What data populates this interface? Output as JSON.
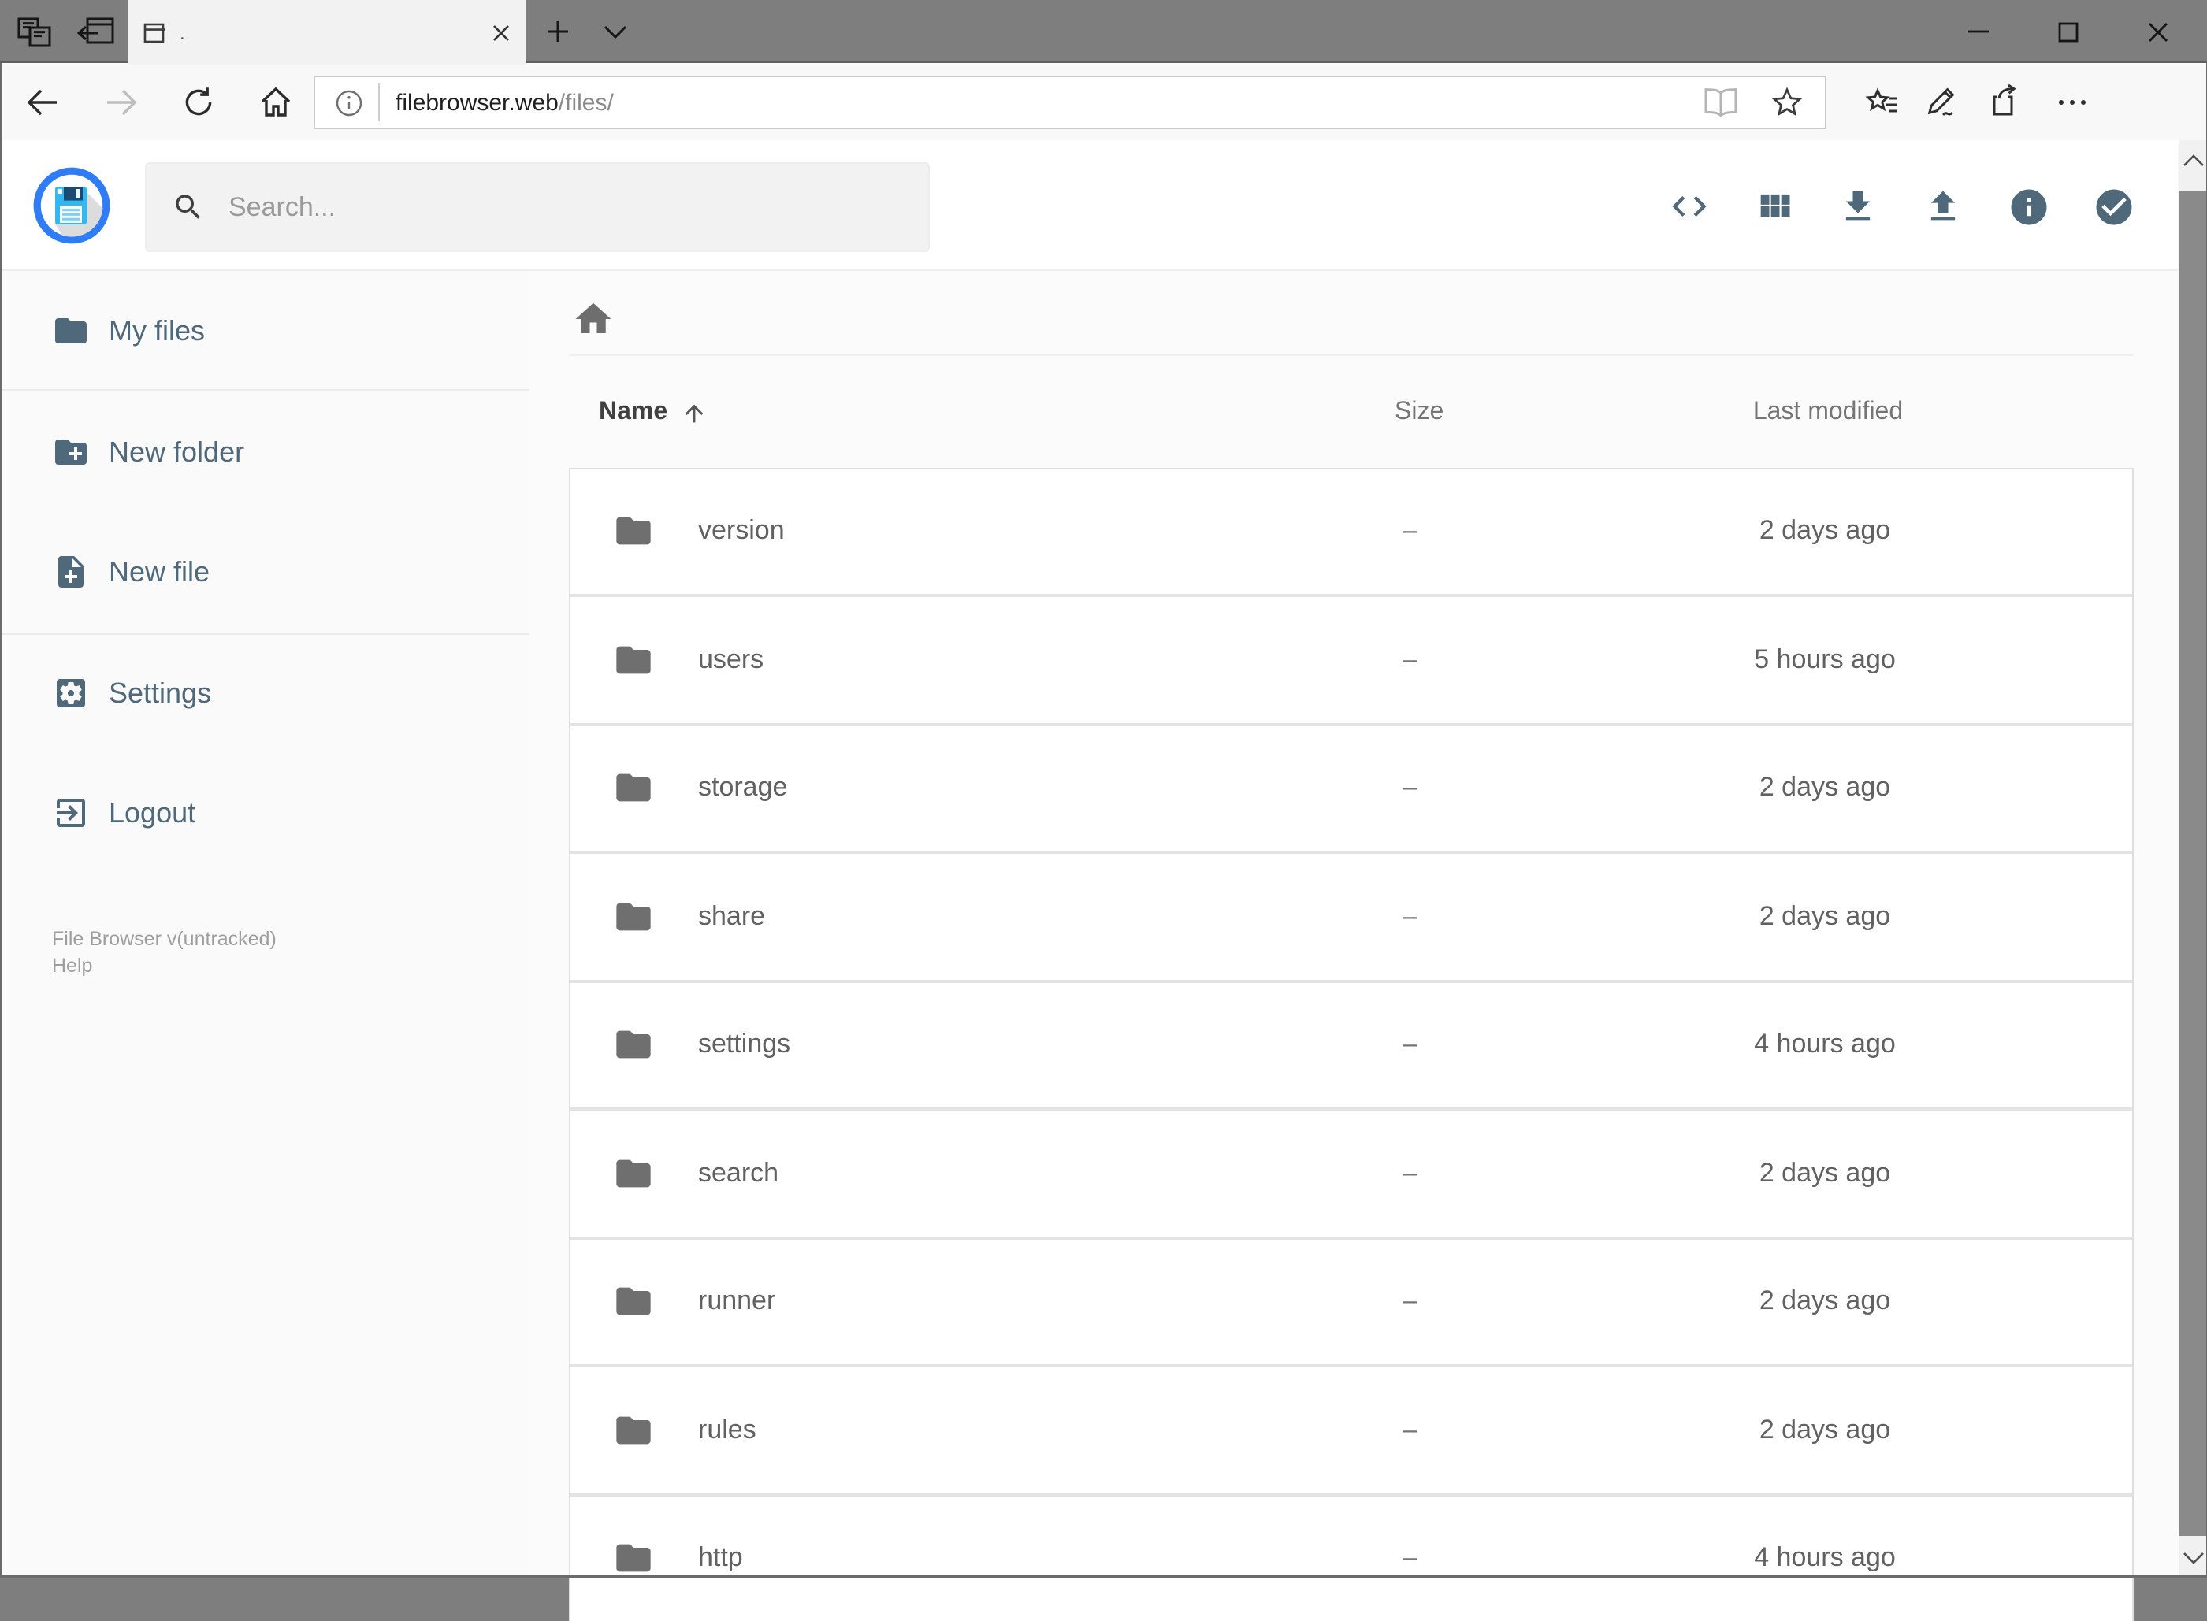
{
  "window": {
    "tab": {
      "title": "."
    },
    "controls": {
      "minimize": "minimize",
      "maximize": "maximize",
      "close": "close"
    }
  },
  "browser": {
    "url": {
      "host": "filebrowser.web",
      "path": "/files/"
    }
  },
  "app": {
    "search": {
      "placeholder": "Search..."
    },
    "header_icons": [
      "code",
      "grid-view",
      "download",
      "upload",
      "info",
      "select-multiple"
    ],
    "sidebar": {
      "items": [
        {
          "icon": "folder",
          "label": "My files"
        },
        {
          "icon": "folder-plus",
          "label": "New folder"
        },
        {
          "icon": "file-plus",
          "label": "New file"
        },
        {
          "icon": "settings-gear",
          "label": "Settings"
        },
        {
          "icon": "logout",
          "label": "Logout"
        }
      ],
      "footer": {
        "version": "File Browser v(untracked)",
        "help": "Help"
      }
    },
    "breadcrumb": {
      "root": "home"
    },
    "listing": {
      "columns": {
        "name": "Name",
        "size": "Size",
        "modified": "Last modified"
      },
      "sort": {
        "column": "Name",
        "direction": "ascending"
      },
      "rows": [
        {
          "name": "version",
          "size": "–",
          "modified": "2 days ago"
        },
        {
          "name": "users",
          "size": "–",
          "modified": "5 hours ago"
        },
        {
          "name": "storage",
          "size": "–",
          "modified": "2 days ago"
        },
        {
          "name": "share",
          "size": "–",
          "modified": "2 days ago"
        },
        {
          "name": "settings",
          "size": "–",
          "modified": "4 hours ago"
        },
        {
          "name": "search",
          "size": "–",
          "modified": "2 days ago"
        },
        {
          "name": "runner",
          "size": "–",
          "modified": "2 days ago"
        },
        {
          "name": "rules",
          "size": "–",
          "modified": "2 days ago"
        },
        {
          "name": "http",
          "size": "–",
          "modified": "4 hours ago"
        }
      ]
    }
  },
  "colors": {
    "accent_blue": "#2e7cf6",
    "slate_icon": "#50697a",
    "folder_gray": "#6f6f6f",
    "row_text": "#616161",
    "titlebar_gray": "#7e7e7e"
  }
}
